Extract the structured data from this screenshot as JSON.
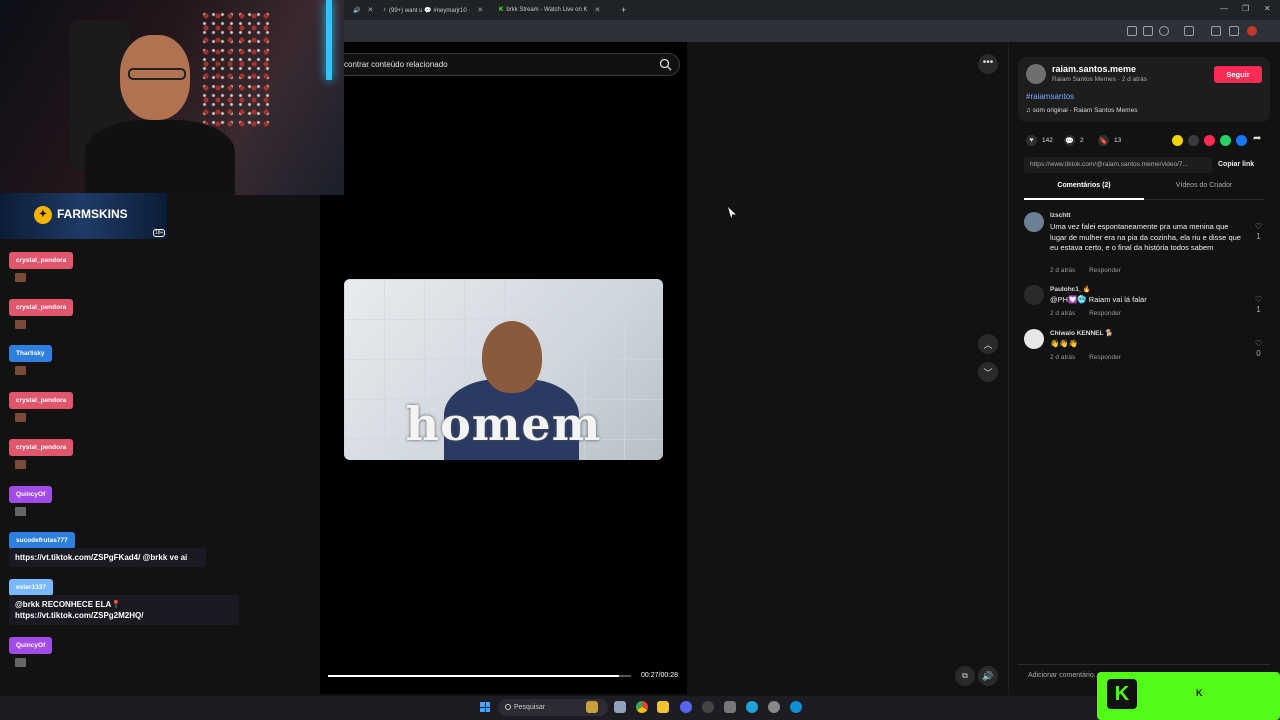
{
  "browser": {
    "tabs": [
      {
        "label": "(99+) want u 💬 #neymarjr10 ·",
        "active": false
      },
      {
        "label": "brkk Stream - Watch Live on K",
        "active": false
      }
    ],
    "new_tab": "+"
  },
  "video": {
    "search_text": "contrar conteúdo relacionado",
    "caption": "homem",
    "time": "00:27/00:28",
    "progress": 0.96
  },
  "author": {
    "name": "raiam.santos.meme",
    "sub": "Raiam Santos Memes · 2 d atrás",
    "follow_label": "Seguir",
    "hashtag": "#raiamsantos",
    "music": "♫ som original - Raiam Santos Memes"
  },
  "stats": {
    "likes": "142",
    "comments": "2",
    "saves": "13"
  },
  "share_colors": [
    "#f2d400",
    "#3a3a3a",
    "#fe2c55",
    "#25d366",
    "#1877f2"
  ],
  "link": {
    "url": "https://www.tiktok.com/@raiam.santos.meme/video/7...",
    "copy_label": "Copiar link"
  },
  "panel_tabs": {
    "comments": "Comentários (2)",
    "videos": "Vídeos do Criador"
  },
  "comments": [
    {
      "user": "lzschtt",
      "text": "Uma vez falei espontaneamente pra uma menina que lugar de mulher era na pia da cozinha, ela riu e disse que eu estava certo, e o final da história todos sabem",
      "time": "2 d atrás",
      "reply": "Responder",
      "likes": "1"
    },
    {
      "user": "Paulohc1_🔥",
      "text": "@PH💟🥶 Raiam vai lá falar",
      "time": "2 d atrás",
      "reply": "Responder",
      "likes": "1"
    },
    {
      "user": "Chiwalo KENNEL 🐕",
      "text": "👋👋👋",
      "time": "2 d atrás",
      "reply": "Responder",
      "likes": "0"
    }
  ],
  "add_comment_placeholder": "Adicionar comentário...",
  "stream": {
    "sponsor": "FARMSKINS",
    "sponsor_age": "18+",
    "chat": [
      {
        "user": "crystal_pendora",
        "color": "#e0576d"
      },
      {
        "user": "crystal_pendora",
        "color": "#e0576d"
      },
      {
        "user": "Tharlisky",
        "color": "#2f7fe0"
      },
      {
        "user": "crystal_pendora",
        "color": "#e0576d"
      },
      {
        "user": "crystal_pendora",
        "color": "#e0576d"
      },
      {
        "user": "QuincyOf",
        "color": "#a24be8"
      },
      {
        "user": "sucodefrutas777",
        "color": "#2f7fe0",
        "message": "https://vt.tiktok.com/ZSPgFKad4/ @brkk ve ai"
      },
      {
        "user": "ester1337",
        "color": "#7ab8ff",
        "message": "@brkk RECONHECE ELA📍https://vt.tiktok.com/ZSPg2M2HQ/"
      },
      {
        "user": "QuincyOf",
        "color": "#a24be8"
      }
    ]
  },
  "taskbar": {
    "search_placeholder": "Pesquisar"
  },
  "kick_mark": "K"
}
